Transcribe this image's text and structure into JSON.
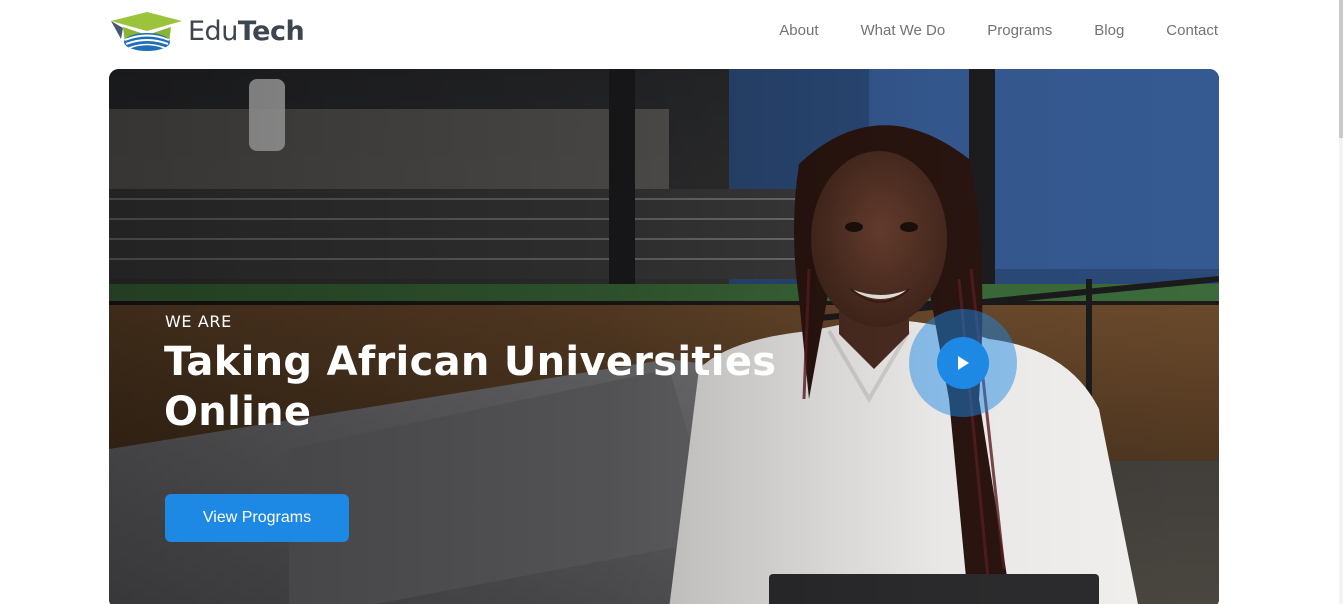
{
  "brand": {
    "name_part1": "Edu",
    "name_part2": "Tech",
    "logo_icon": "graduation-cap-icon"
  },
  "nav": {
    "items": [
      "About",
      "What We Do",
      "Programs",
      "Blog",
      "Contact"
    ]
  },
  "hero": {
    "eyebrow": "WE ARE",
    "title_line1": "Taking African Universities",
    "title_line2": "Online",
    "cta_label": "View Programs",
    "play_icon": "play-icon"
  },
  "colors": {
    "accent": "#1e88e5",
    "logo_green": "#9bc43b",
    "logo_blue": "#1e6fb8",
    "logo_text": "#3e4550",
    "nav_text": "#737373"
  }
}
